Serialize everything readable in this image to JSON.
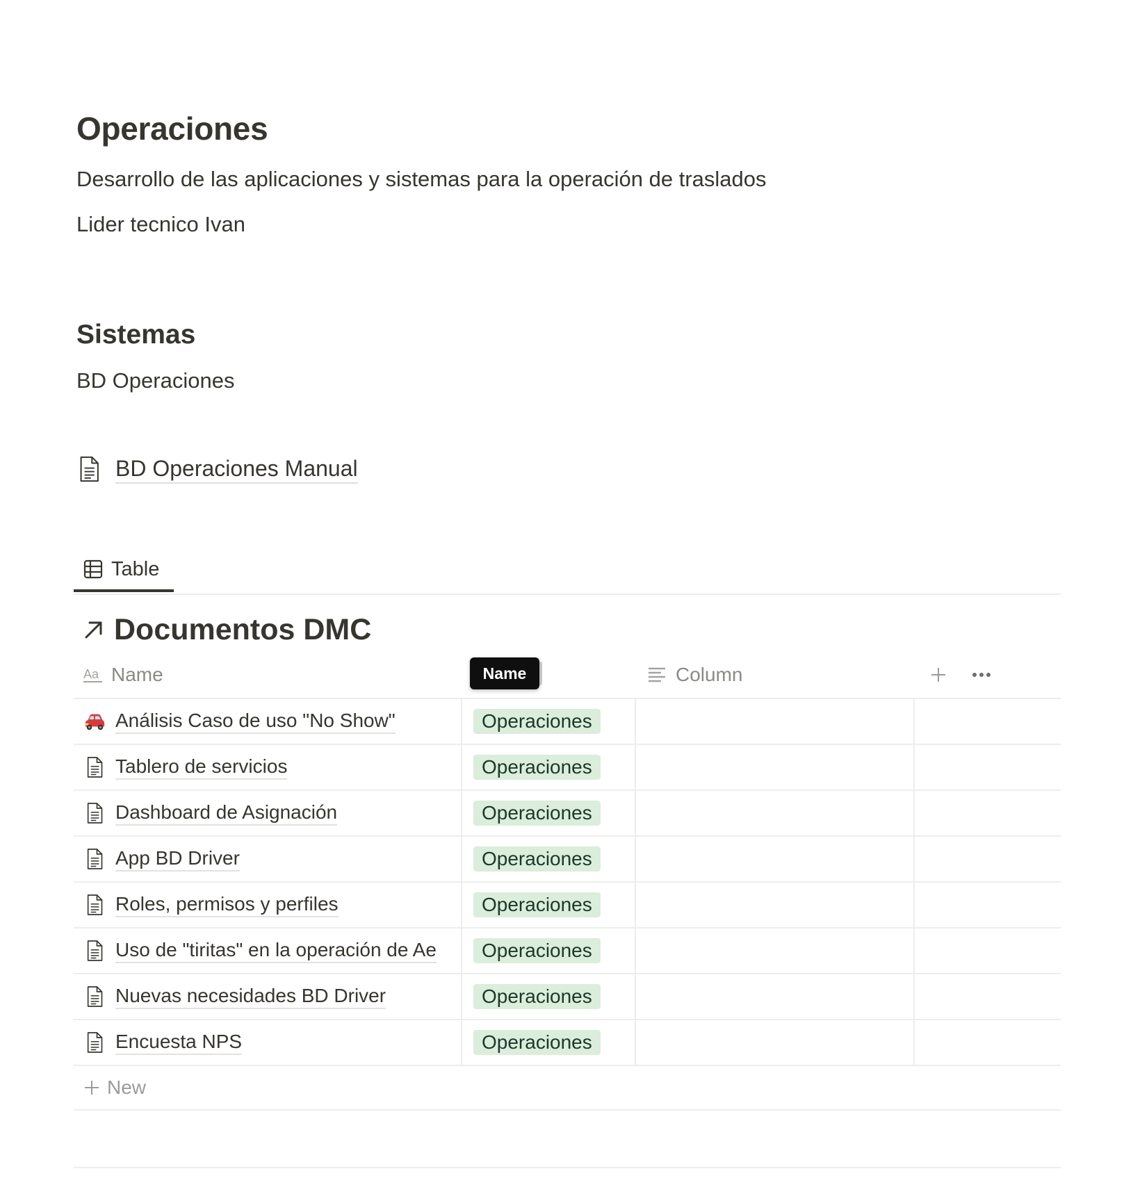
{
  "page": {
    "title": "Operaciones",
    "description": "Desarrollo de las aplicaciones y sistemas para la operación de traslados",
    "lead": "Lider tecnico Ivan"
  },
  "sistemas": {
    "heading": "Sistemas",
    "text": "BD Operaciones",
    "page_link": "BD Operaciones Manual"
  },
  "view": {
    "tab_label": "Table",
    "database_title": "Documentos DMC"
  },
  "table": {
    "columns": {
      "name": "Name",
      "column": "Column"
    },
    "tooltip": "Name",
    "new_label": "New",
    "tag_color": "#dbeddb",
    "rows": [
      {
        "icon": "car-emoji",
        "title": "Análisis Caso de uso \"No Show\"",
        "tag": "Operaciones"
      },
      {
        "icon": "document-icon",
        "title": "Tablero de servicios",
        "tag": "Operaciones"
      },
      {
        "icon": "document-icon",
        "title": "Dashboard de Asignación",
        "tag": "Operaciones"
      },
      {
        "icon": "document-icon",
        "title": "App BD Driver",
        "tag": "Operaciones"
      },
      {
        "icon": "document-icon",
        "title": "Roles, permisos y perfiles",
        "tag": "Operaciones"
      },
      {
        "icon": "document-icon",
        "title": "Uso de \"tiritas\" en la operación de Ae",
        "tag": "Operaciones"
      },
      {
        "icon": "document-icon",
        "title": "Nuevas necesidades BD Driver",
        "tag": "Operaciones"
      },
      {
        "icon": "document-icon",
        "title": "Encuesta NPS",
        "tag": "Operaciones"
      }
    ]
  }
}
